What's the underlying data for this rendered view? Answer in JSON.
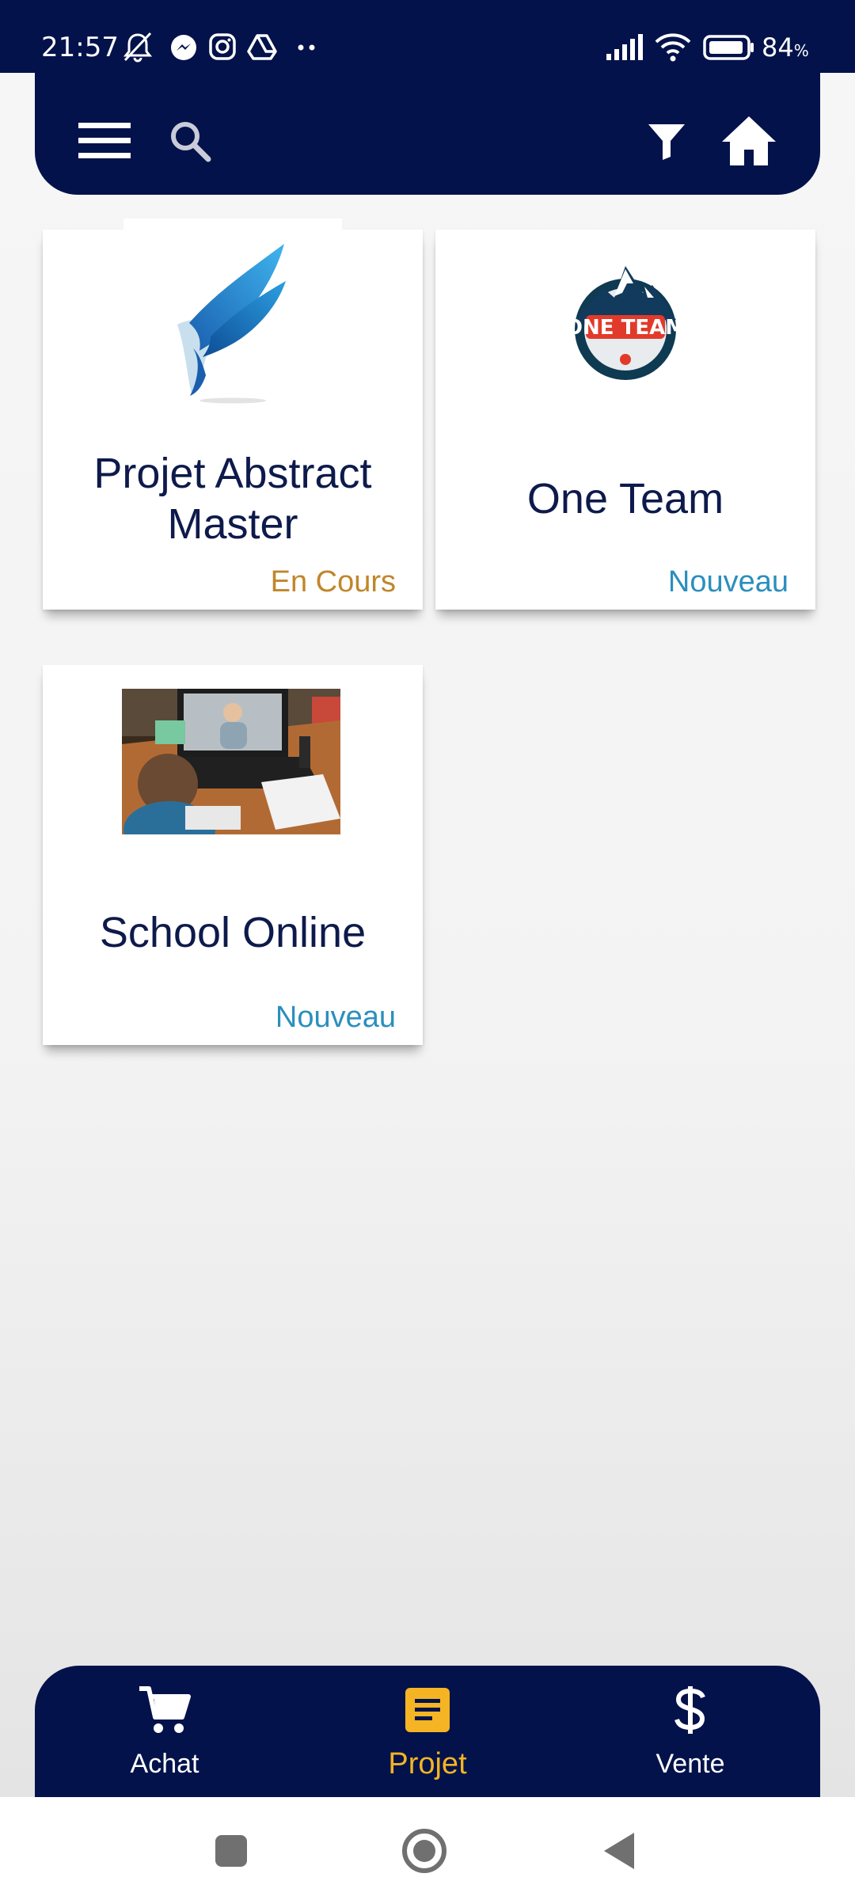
{
  "status_bar": {
    "time": "21:57",
    "battery_percent": "84",
    "battery_unit": "%",
    "icons": [
      "bell-off-icon",
      "messenger-icon",
      "instagram-icon",
      "drive-icon",
      "more-dots-icon",
      "signal-icon",
      "wifi-icon",
      "battery-icon"
    ]
  },
  "app_bar": {
    "background": "#03124a",
    "actions": [
      "menu-icon",
      "search-icon",
      "filter-icon",
      "home-icon"
    ]
  },
  "projects": [
    {
      "title": "Projet Abstract Master",
      "status": "En Cours",
      "image": "blue-eagle-logo",
      "status_color": "#c1862b"
    },
    {
      "title": "One Team",
      "status": "Nouveau",
      "image": "one-team-badge-logo",
      "badge_text": "ONE TEAM",
      "status_color": "#2b8fbd"
    },
    {
      "title": "School Online",
      "status": "Nouveau",
      "image": "child-online-class-photo",
      "status_color": "#2b8fbd"
    }
  ],
  "bottom_nav": {
    "items": [
      {
        "label": "Achat",
        "icon": "cart-icon",
        "active": false
      },
      {
        "label": "Projet",
        "icon": "document-icon",
        "active": true
      },
      {
        "label": "Vente",
        "icon": "dollar-icon",
        "active": false
      }
    ],
    "active_color": "#f4b424"
  },
  "system_nav": [
    "recents-button",
    "home-button",
    "back-button"
  ]
}
